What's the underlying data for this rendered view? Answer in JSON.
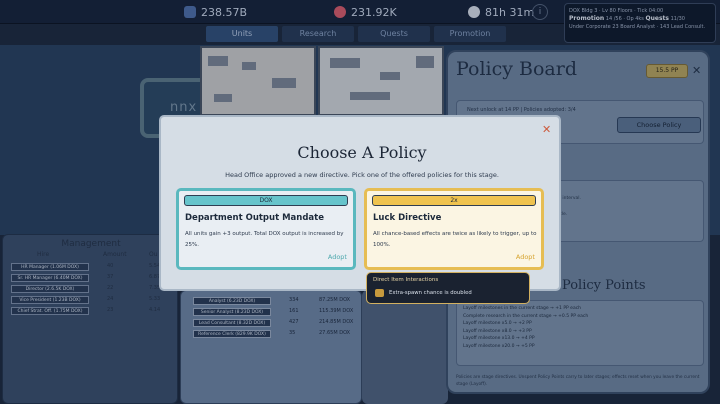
{
  "topbar": {
    "money": "238.57B",
    "brainpower": "231.92K",
    "time": "81h 31m",
    "info_icon": "i"
  },
  "info_panel": {
    "line1": "DOX Bldg 3 · Lv 80 Floors · Tick 04:00",
    "promotion_label": "Promotion",
    "promotion_value": "14 /56 · Op 4ks",
    "quests_label": "Quests",
    "quests_value": "11/30",
    "line3": "Under Corporate 23 Board Analyst · 143 Lead Consult."
  },
  "tabs": [
    "Units",
    "Research",
    "Quests",
    "Promotion"
  ],
  "background": {
    "dox_sign": "nnx"
  },
  "management": {
    "title": "Management",
    "headers": {
      "hire": "Hire",
      "amount": "Amount",
      "output": "Ou"
    },
    "rows": [
      {
        "hire": "HR Manager (1.06M DOX)",
        "amount": "40",
        "output": "5.54"
      },
      {
        "hire": "Sr. HR Manager (6.40M DOX)",
        "amount": "37",
        "output": "6.87"
      },
      {
        "hire": "Director (2.6.5K DOX)",
        "amount": "22",
        "output": "7.35"
      },
      {
        "hire": "Vice President (1.23B DOX)",
        "amount": "24",
        "output": "5.33"
      },
      {
        "hire": "Chief Strat. Off. (1.75M DOX)",
        "amount": "23",
        "output": "4.14"
      }
    ]
  },
  "units_rows": [
    {
      "hire": "Analyst (6.23D DOX)",
      "amount": "334",
      "output": "87.25M DOX"
    },
    {
      "hire": "Senior Analyst (8.23D DOX)",
      "amount": "161",
      "output": "115.39M DOX"
    },
    {
      "hire": "Lead Consultant (8.32D DOX)",
      "amount": "427",
      "output": "214.85M DOX"
    },
    {
      "hire": "Reference Clerk (829.9K DOX)",
      "amount": "35",
      "output": "27.65M DOX"
    }
  ],
  "policy_board": {
    "title": "Policy Board",
    "pp_badge": "15.5 PP",
    "close": "✕",
    "stage_text": "Next unlock at 14 PP  |  Policies adopted: 3/4",
    "choose_button": "Choose Policy",
    "list_lines": [
      "...",
      "...spawns run at half interval.",
      "...",
      "...produced each cycle."
    ],
    "points_title": "Policy Points",
    "points_lines": [
      "Layoff milestones in the current stage → +1 PP each",
      "Complete research in the current stage → +0.5 PP each",
      "Layoff milestone x5.0 → +2 PP",
      "Layoff milestone x8.0 → +3 PP",
      "Layoff milestone x13.0 → +4 PP",
      "Layoff milestone x20.0 → +5 PP"
    ],
    "footer": "Policies are stage directives. Unspent Policy Points carry to later stages; effects reset when you leave the current stage (Layoff)."
  },
  "modal": {
    "title": "Choose A Policy",
    "subtitle": "Head Office approved a new directive. Pick one of the offered policies for this stage.",
    "close": "✕",
    "cards": [
      {
        "tag": "DOX",
        "name": "Department Output Mandate",
        "description": "All units gain +3 output. Total DOX output is increased by 25%.",
        "adopt": "Adopt"
      },
      {
        "tag": "2x",
        "name": "Luck Directive",
        "description": "All chance-based effects are twice as likely to trigger, up to 100%.",
        "adopt": "Adopt"
      }
    ]
  },
  "tooltip": {
    "title": "Direct Item Interactions",
    "text": "Extra-spawn chance is doubled"
  },
  "colors": {
    "accent_teal": "#5ab8be",
    "accent_gold": "#e6bd53",
    "close_red": "#cc5a3c"
  }
}
